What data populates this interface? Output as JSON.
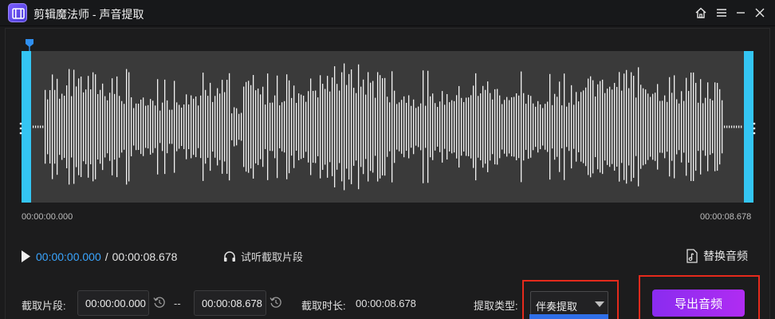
{
  "titlebar": {
    "app_name": "剪辑魔法师",
    "separator": " - ",
    "page_name": "声音提取",
    "home_icon": "home-icon",
    "menu_icon": "hamburger-menu-icon",
    "minimize_icon": "minimize-icon",
    "close_icon": "close-icon"
  },
  "timeline": {
    "start_time": "00:00:00.000",
    "end_time": "00:00:08.678"
  },
  "player": {
    "current_time": "00:00:00.000",
    "separator": "/",
    "total_time": "00:00:08.678",
    "preview_label": "试听截取片段",
    "replace_label": "替换音频"
  },
  "clip": {
    "segment_label": "截取片段:",
    "start_value": "00:00:00.000",
    "dash": "--",
    "end_value": "00:00:08.678",
    "duration_label": "截取时长:",
    "duration_value": "00:00:08.678"
  },
  "extract": {
    "type_label": "提取类型:",
    "selected": "伴奏提取"
  },
  "export": {
    "label": "导出音频"
  },
  "colors": {
    "accent_blue": "#34c5f3",
    "time_blue": "#3aa5ff",
    "highlight_red": "#e52a1c",
    "export_purple": "#9b2cf0"
  }
}
